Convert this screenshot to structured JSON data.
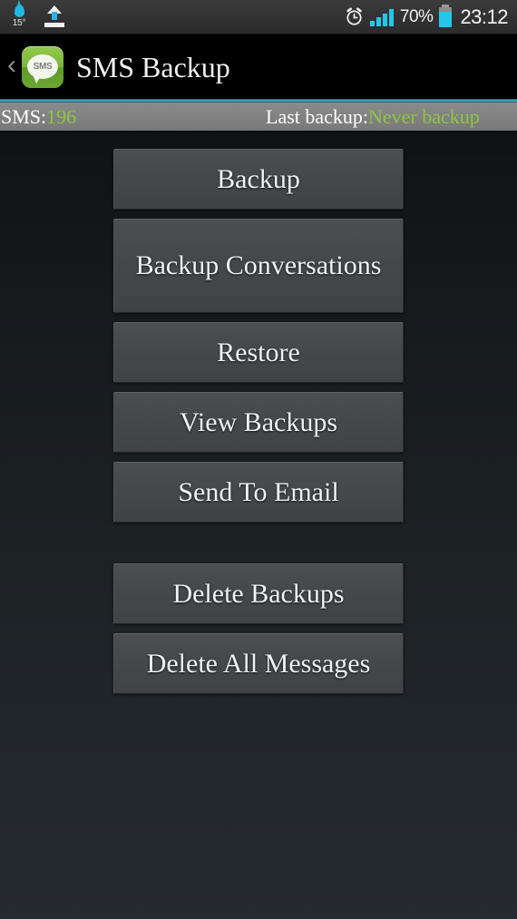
{
  "status_bar": {
    "weather_icon": "water-drop-icon",
    "temperature": "15°",
    "upload_icon": "upload-arrow-icon",
    "alarm_icon": "alarm-clock-icon",
    "signal_icon": "signal-bars-icon",
    "battery_percent": "70%",
    "battery_icon": "battery-icon",
    "clock": "23:12",
    "accent_color": "#23c8e8"
  },
  "title_bar": {
    "back_label": "‹",
    "app_icon_text": "SMS",
    "title": "SMS Backup",
    "icon_color": "#7db63c",
    "rule_color": "#46b4cf"
  },
  "info_bar": {
    "sms_label": "SMS:",
    "sms_count": "196",
    "last_backup_label": "Last backup:",
    "last_backup_value": "Never backup",
    "value_color": "#8dc63f",
    "bar_color": "#828282"
  },
  "buttons": [
    {
      "label": "Backup",
      "name": "backup-button",
      "size": "h1",
      "spaced": false
    },
    {
      "label": "Backup Conversations",
      "name": "backup-conversations-button",
      "size": "h2",
      "spaced": false
    },
    {
      "label": "Restore",
      "name": "restore-button",
      "size": "h1",
      "spaced": false
    },
    {
      "label": "View Backups",
      "name": "view-backups-button",
      "size": "h1",
      "spaced": false
    },
    {
      "label": "Send To Email",
      "name": "send-to-email-button",
      "size": "h1",
      "spaced": false
    },
    {
      "label": "Delete Backups",
      "name": "delete-backups-button",
      "size": "h1",
      "spaced": true
    },
    {
      "label": "Delete All Messages",
      "name": "delete-all-messages-button",
      "size": "h1",
      "spaced": false
    }
  ]
}
